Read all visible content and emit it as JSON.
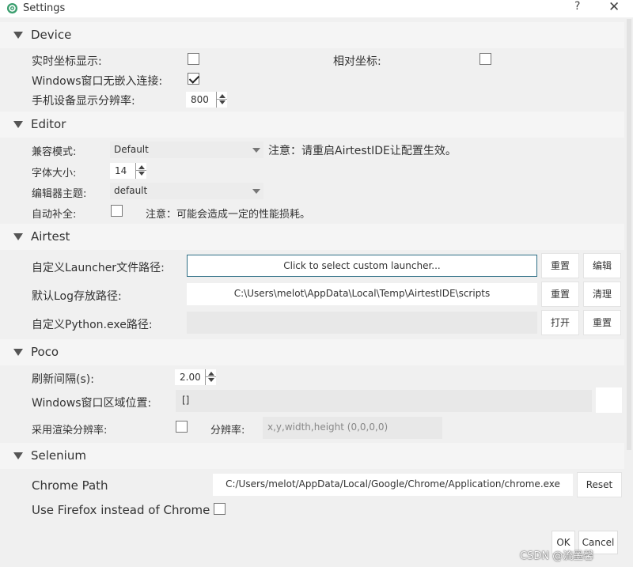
{
  "window": {
    "title": "Settings",
    "help": "?",
    "close": "✕"
  },
  "device": {
    "title": "Device",
    "realtime_coords_label": "实时坐标显示:",
    "relative_coords_label": "相对坐标:",
    "windows_no_embed_label": "Windows窗口无嵌入连接:",
    "windows_no_embed_checked": true,
    "resolution_label": "手机设备显示分辨率:",
    "resolution_value": "800"
  },
  "editor": {
    "title": "Editor",
    "compat_label": "兼容模式:",
    "compat_value": "Default",
    "compat_note": "注意：请重启AirtestIDE让配置生效。",
    "font_size_label": "字体大小:",
    "font_size_value": "14",
    "theme_label": "编辑器主题:",
    "theme_value": "default",
    "autocomplete_label": "自动补全:",
    "autocomplete_note": "注意：可能会造成一定的性能损耗。"
  },
  "airtest": {
    "title": "Airtest",
    "launcher_label": "自定义Launcher文件路径:",
    "launcher_placeholder": "Click to select custom launcher...",
    "launcher_reset": "重置",
    "launcher_edit": "编辑",
    "log_label": "默认Log存放路径:",
    "log_value": "C:\\Users\\melot\\AppData\\Local\\Temp\\AirtestIDE\\scripts",
    "log_reset": "重置",
    "log_clear": "清理",
    "python_label": "自定义Python.exe路径:",
    "python_open": "打开",
    "python_reset": "重置"
  },
  "poco": {
    "title": "Poco",
    "refresh_label": "刷新间隔(s):",
    "refresh_value": "2.00",
    "region_label": "Windows窗口区域位置:",
    "region_value": "[]",
    "render_res_label": "采用渲染分辨率:",
    "resolution_label": "分辨率:",
    "resolution_placeholder": "x,y,width,height (0,0,0,0)"
  },
  "selenium": {
    "title": "Selenium",
    "chrome_label": "Chrome Path",
    "chrome_value": "C:/Users/melot/AppData/Local/Google/Chrome/Application/chrome.exe",
    "chrome_reset": "Reset",
    "firefox_label": "Use Firefox instead of Chrome"
  },
  "footer": {
    "ok": "OK",
    "cancel": "Cancel",
    "watermark": "CSDN @流墨馨"
  },
  "colors": {
    "accent_border": "#2e6f86",
    "app_icon": "#3a9e6e"
  }
}
